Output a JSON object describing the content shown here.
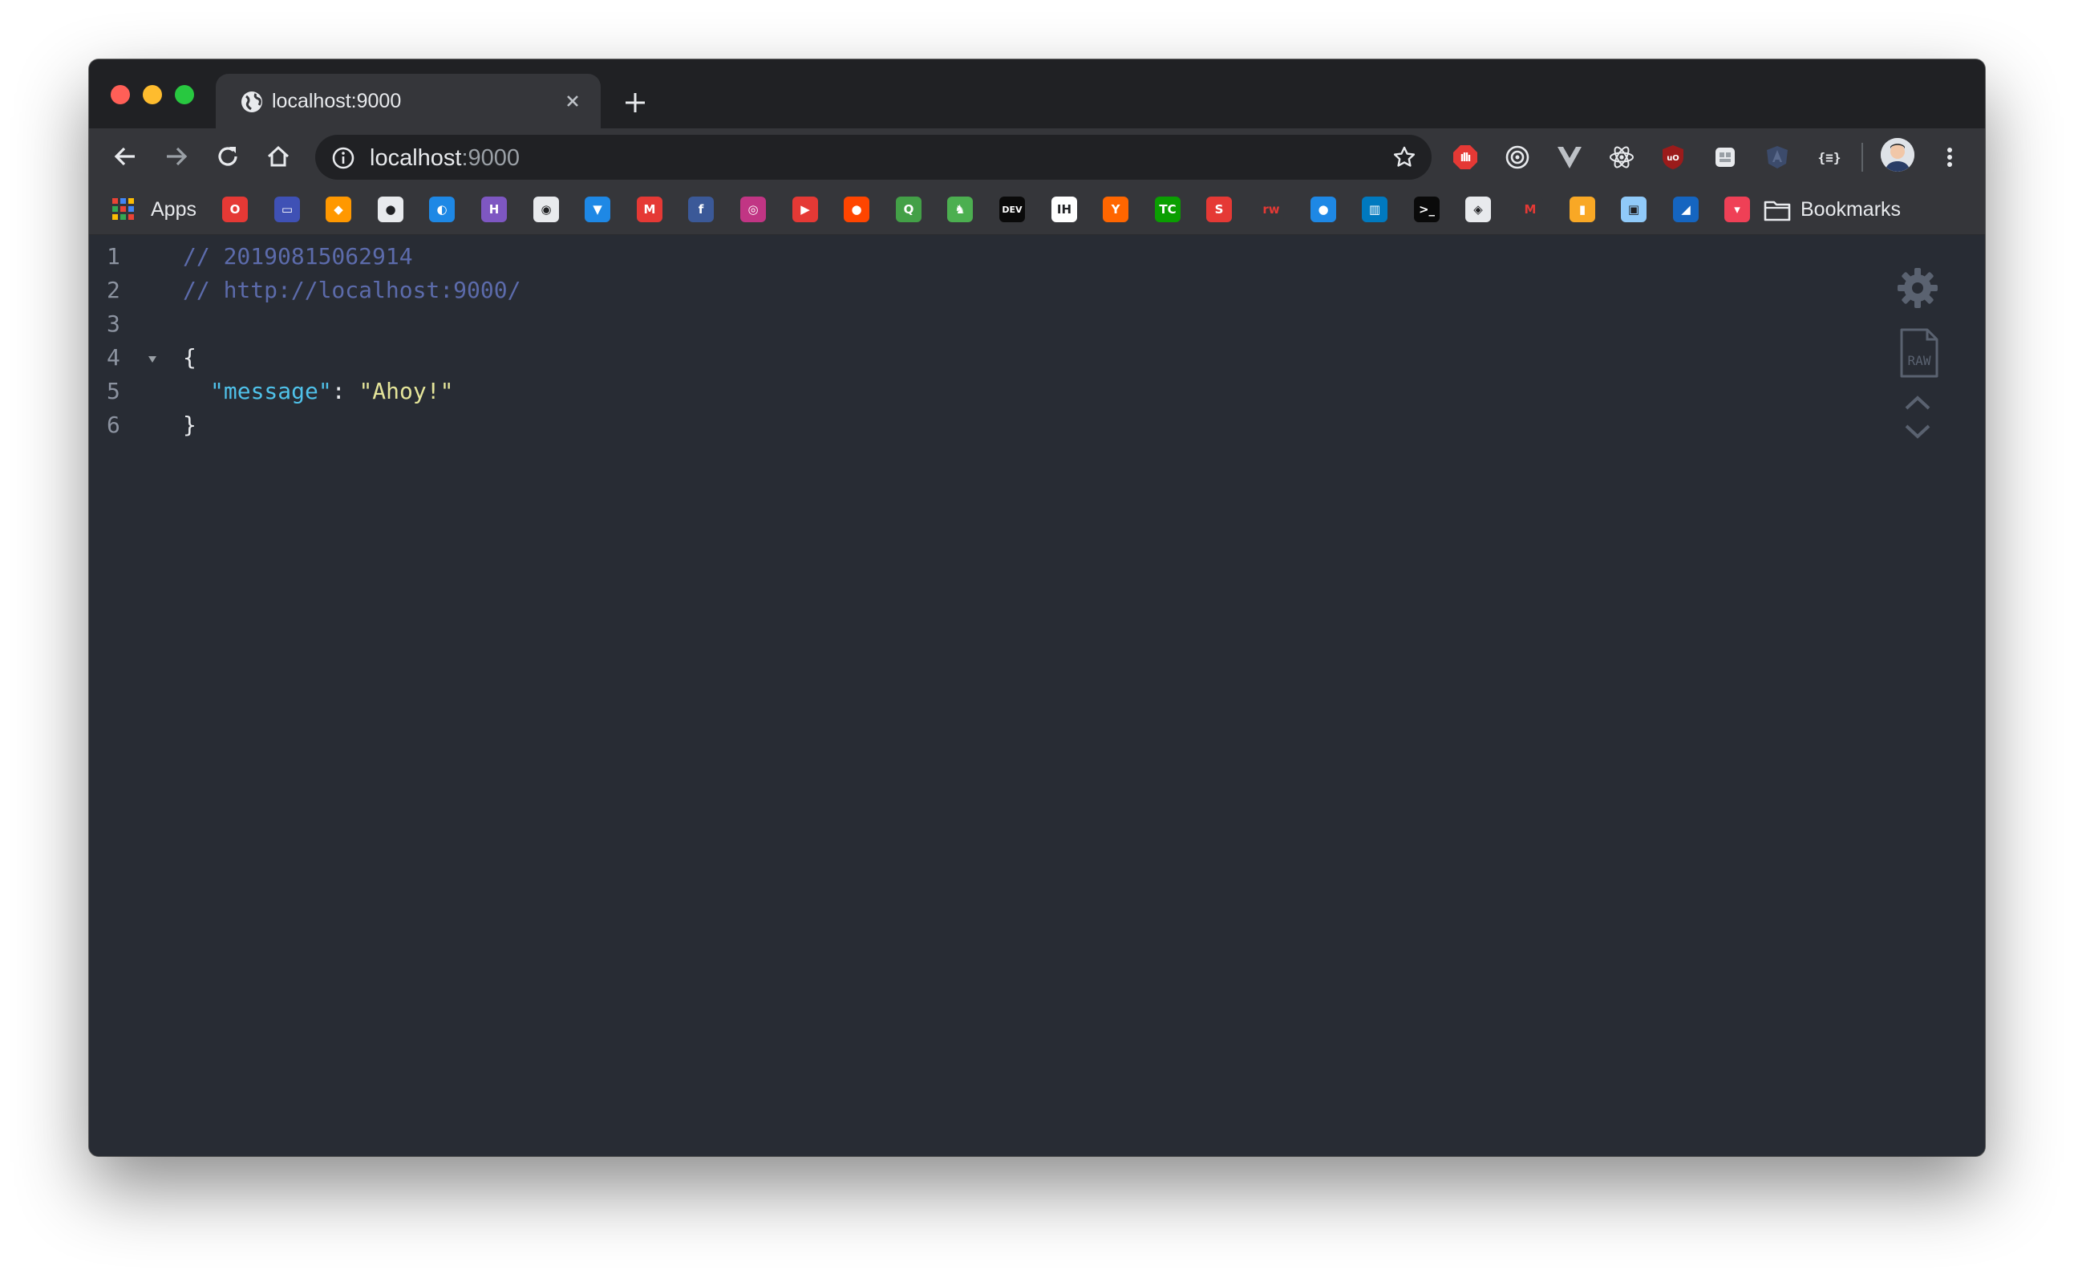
{
  "window": {
    "traffic_lights": [
      "close",
      "minimize",
      "zoom"
    ]
  },
  "tab": {
    "title": "localhost:9000",
    "favicon": "globe-icon",
    "close_icon": "close-icon"
  },
  "toolbar": {
    "back": "back-arrow-icon",
    "forward": "forward-arrow-icon",
    "reload": "reload-icon",
    "home": "home-icon",
    "url_host": "localhost",
    "url_port": ":9000",
    "star": "star-icon",
    "extensions": [
      {
        "name": "adblock-extension-icon",
        "color": "#e53935"
      },
      {
        "name": "target-extension-icon",
        "color": "#e8eaed"
      },
      {
        "name": "vue-devtools-extension-icon",
        "color": "#9aa0a6"
      },
      {
        "name": "react-devtools-extension-icon",
        "color": "#e8eaed"
      },
      {
        "name": "ublock-origin-extension-icon",
        "color": "#b71c1c"
      },
      {
        "name": "generic-extension-icon",
        "color": "#e8eaed"
      },
      {
        "name": "angular-extension-icon",
        "color": "#3c4b6b"
      },
      {
        "name": "json-viewer-extension-icon",
        "color": "#e8eaed"
      }
    ],
    "profile": "avatar",
    "menu": "kebab-menu-icon"
  },
  "bookmarks": {
    "apps_label": "Apps",
    "folder_label": "Bookmarks",
    "items": [
      {
        "name": "opera-bookmark-icon",
        "color": "#e53935",
        "glyph": "O"
      },
      {
        "name": "trello-like-bookmark-icon",
        "color": "#3f51b5",
        "glyph": "▭"
      },
      {
        "name": "aws-box-bookmark-icon",
        "color": "#ff9800",
        "glyph": "◆"
      },
      {
        "name": "panda-bookmark-icon",
        "color": "#e8eaed",
        "glyph": "●"
      },
      {
        "name": "digitalocean-bookmark-icon",
        "color": "#1e88e5",
        "glyph": "◐"
      },
      {
        "name": "heroku-bookmark-icon",
        "color": "#7e57c2",
        "glyph": "H"
      },
      {
        "name": "github-bookmark-icon",
        "color": "#e8eaed",
        "glyph": "◉"
      },
      {
        "name": "bitbucket-bookmark-icon",
        "color": "#1e88e5",
        "glyph": "▼"
      },
      {
        "name": "gmail-bookmark-icon",
        "color": "#e53935",
        "glyph": "M"
      },
      {
        "name": "facebook-bookmark-icon",
        "color": "#3b5998",
        "glyph": "f"
      },
      {
        "name": "instagram-bookmark-icon",
        "color": "#c13584",
        "glyph": "◎"
      },
      {
        "name": "youtube-bookmark-icon",
        "color": "#e53935",
        "glyph": "▶"
      },
      {
        "name": "reddit-bookmark-icon",
        "color": "#ff4500",
        "glyph": "●"
      },
      {
        "name": "feedly-bookmark-icon",
        "color": "#43a047",
        "glyph": "Q"
      },
      {
        "name": "android-bookmark-icon",
        "color": "#4caf50",
        "glyph": "♞"
      },
      {
        "name": "devto-bookmark-icon",
        "color": "#0a0a0a",
        "glyph": "DEV"
      },
      {
        "name": "indiehackers-bookmark-icon",
        "color": "#ffffff",
        "glyph": "IH"
      },
      {
        "name": "hackernews-bookmark-icon",
        "color": "#ff6600",
        "glyph": "Y"
      },
      {
        "name": "techcrunch-bookmark-icon",
        "color": "#0a9e01",
        "glyph": "TC"
      },
      {
        "name": "scribd-bookmark-icon",
        "color": "#e53935",
        "glyph": "S"
      },
      {
        "name": "raywenderlich-bookmark-icon",
        "color": "#35363a",
        "glyph": "rw"
      },
      {
        "name": "drop-bookmark-icon",
        "color": "#1e88e5",
        "glyph": "●"
      },
      {
        "name": "trello-bookmark-icon",
        "color": "#0079bf",
        "glyph": "▥"
      },
      {
        "name": "terminal-bookmark-icon",
        "color": "#0a0a0a",
        "glyph": ">_"
      },
      {
        "name": "codepen-bookmark-icon",
        "color": "#e8eaed",
        "glyph": "◈"
      },
      {
        "name": "medium-like-bookmark-icon",
        "color": "#35363a",
        "glyph": "M"
      },
      {
        "name": "analytics-bookmark-icon",
        "color": "#f9a825",
        "glyph": "▮"
      },
      {
        "name": "briefcase-bookmark-icon",
        "color": "#90caf9",
        "glyph": "▣"
      },
      {
        "name": "azure-bookmark-icon",
        "color": "#1565c0",
        "glyph": "◢"
      },
      {
        "name": "pocket-bookmark-icon",
        "color": "#ef4056",
        "glyph": "▾"
      }
    ]
  },
  "json_view": {
    "lines": [
      {
        "num": "1",
        "comment": "// 20190815062914"
      },
      {
        "num": "2",
        "comment": "// http://localhost:9000/"
      },
      {
        "num": "3"
      },
      {
        "num": "4",
        "open": "{"
      },
      {
        "num": "5",
        "key": "\"message\"",
        "colon": ": ",
        "value": "\"Ahoy!\""
      },
      {
        "num": "6",
        "close": "}"
      }
    ]
  },
  "sidebar_tools": [
    "gear-icon",
    "raw-file-icon",
    "collapse-up-icon",
    "collapse-down-icon"
  ]
}
